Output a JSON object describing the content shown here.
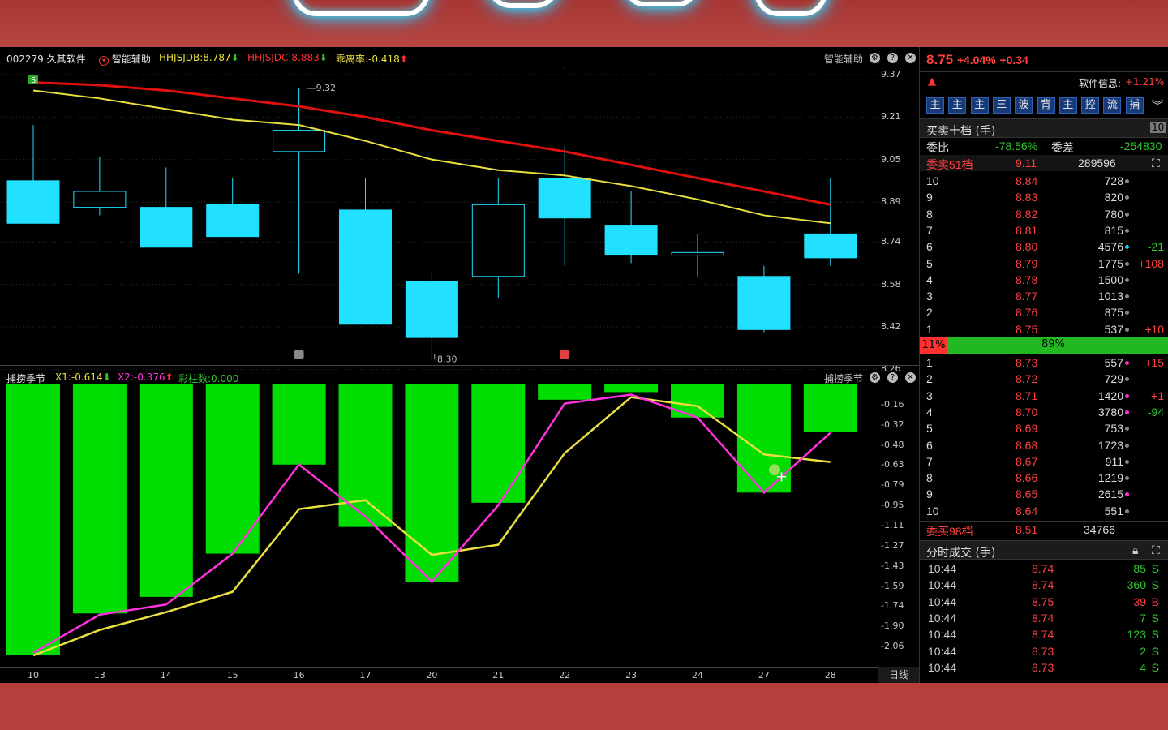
{
  "chart_header": {
    "stock_code_name": "002279 久其软件",
    "assist_label": "智能辅助",
    "hhjsjdb_label": "HHJSJDB:8.787",
    "hhjsjdc_label": "HHJSJDC:8.883",
    "deviation_label": "乖离率:-0.418",
    "right_label": "智能辅助"
  },
  "indicator_header": {
    "name": "捕捞季节",
    "x1_label": "X1:-0.614",
    "x2_label": "X2:-0.376",
    "bar_label": "彩柱数:0.000",
    "right_label": "捕捞季节"
  },
  "price_axis": [
    "9.37",
    "9.21",
    "9.05",
    "8.89",
    "8.74",
    "8.58",
    "8.42",
    "8.26"
  ],
  "indicator_axis": [
    "-0.16",
    "-0.32",
    "-0.48",
    "-0.63",
    "-0.79",
    "-0.95",
    "-1.11",
    "-1.27",
    "-1.43",
    "-1.59",
    "-1.74",
    "-1.90",
    "-2.06"
  ],
  "date_axis": [
    "10",
    "13",
    "14",
    "15",
    "16",
    "17",
    "20",
    "21",
    "22",
    "23",
    "24",
    "27",
    "28"
  ],
  "period_button": "日线",
  "annotations": {
    "high": "9.32",
    "low": "8.30",
    "signal_badge": "S"
  },
  "chart_data": [
    {
      "type": "candlestick",
      "x": [
        "10",
        "13",
        "14",
        "15",
        "16",
        "17",
        "20",
        "21",
        "22",
        "23",
        "24",
        "27",
        "28"
      ],
      "open": [
        8.97,
        8.87,
        8.87,
        8.88,
        9.08,
        8.86,
        8.59,
        8.61,
        8.98,
        8.8,
        8.69,
        8.61,
        8.77
      ],
      "high": [
        9.18,
        9.06,
        9.02,
        8.98,
        9.32,
        8.98,
        8.63,
        8.98,
        9.1,
        8.93,
        8.77,
        8.65,
        8.98
      ],
      "low": [
        8.85,
        8.84,
        8.74,
        8.76,
        8.62,
        8.45,
        8.3,
        8.53,
        8.65,
        8.66,
        8.61,
        8.4,
        8.65
      ],
      "close": [
        8.81,
        8.93,
        8.72,
        8.76,
        9.16,
        8.43,
        8.38,
        8.88,
        8.83,
        8.69,
        8.7,
        8.41,
        8.68
      ],
      "ma_red": [
        9.34,
        9.33,
        9.31,
        9.28,
        9.25,
        9.21,
        9.16,
        9.12,
        9.08,
        9.03,
        8.98,
        8.93,
        8.88
      ],
      "ma_yellow": [
        9.31,
        9.28,
        9.24,
        9.2,
        9.18,
        9.12,
        9.05,
        9.01,
        8.99,
        8.95,
        8.9,
        8.84,
        8.81
      ],
      "ylim": [
        8.24,
        9.4
      ]
    },
    {
      "type": "bar",
      "categories": [
        "10",
        "13",
        "14",
        "15",
        "16",
        "17",
        "20",
        "21",
        "22",
        "23",
        "24",
        "27",
        "28"
      ],
      "values": [
        -2.13,
        -1.8,
        -1.67,
        -1.33,
        -0.63,
        -1.12,
        -1.55,
        -0.93,
        -0.12,
        -0.06,
        -0.26,
        -0.85,
        -0.37
      ],
      "series": [
        {
          "name": "X1",
          "values": [
            -2.13,
            -1.93,
            -1.79,
            -1.63,
            -0.98,
            -0.91,
            -1.34,
            -1.26,
            -0.54,
            -0.1,
            -0.17,
            -0.55,
            -0.61
          ]
        },
        {
          "name": "X2",
          "values": [
            -2.11,
            -1.81,
            -1.73,
            -1.33,
            -0.63,
            -1.04,
            -1.55,
            -0.95,
            -0.15,
            -0.08,
            -0.26,
            -0.85,
            -0.38
          ]
        }
      ],
      "ylim": [
        -2.2,
        0.0
      ]
    }
  ],
  "quote": {
    "price": "8.75",
    "change_pct": "+4.04%",
    "change": "+0.34",
    "info_label": "软件信息:",
    "info_value": "+1.21%"
  },
  "toolbar_buttons": [
    "主",
    "主",
    "主",
    "三",
    "波",
    "背",
    "主",
    "控",
    "流",
    "捕"
  ],
  "order_book": {
    "title": "买卖十档 (手)",
    "badge": "10",
    "ratio_label": "委比",
    "ratio_value": "-78.56%",
    "diff_label": "委差",
    "diff_value": "-254830",
    "sell_total_label": "委卖51档",
    "sell_total_price": "9.11",
    "sell_total_vol": "289596",
    "asks": [
      {
        "level": "10",
        "price": "8.84",
        "vol": "728",
        "chg": "",
        "dot": "#888888"
      },
      {
        "level": "9",
        "price": "8.83",
        "vol": "820",
        "chg": "",
        "dot": "#888888"
      },
      {
        "level": "8",
        "price": "8.82",
        "vol": "780",
        "chg": "",
        "dot": "#888888"
      },
      {
        "level": "7",
        "price": "8.81",
        "vol": "815",
        "chg": "",
        "dot": "#888888"
      },
      {
        "level": "6",
        "price": "8.80",
        "vol": "4576",
        "chg": "-21",
        "dot": "#22d4ff"
      },
      {
        "level": "5",
        "price": "8.79",
        "vol": "1775",
        "chg": "+108",
        "dot": "#888888"
      },
      {
        "level": "4",
        "price": "8.78",
        "vol": "1500",
        "chg": "",
        "dot": "#888888"
      },
      {
        "level": "3",
        "price": "8.77",
        "vol": "1013",
        "chg": "",
        "dot": "#888888"
      },
      {
        "level": "2",
        "price": "8.76",
        "vol": "875",
        "chg": "",
        "dot": "#888888"
      },
      {
        "level": "1",
        "price": "8.75",
        "vol": "537",
        "chg": "+10",
        "dot": "#888888"
      }
    ],
    "split_sell": "11%",
    "split_buy": "89%",
    "bids": [
      {
        "level": "1",
        "price": "8.73",
        "vol": "557",
        "chg": "+15",
        "dot": "#ff33cc"
      },
      {
        "level": "2",
        "price": "8.72",
        "vol": "729",
        "chg": "",
        "dot": "#888888"
      },
      {
        "level": "3",
        "price": "8.71",
        "vol": "1420",
        "chg": "+1",
        "dot": "#ff33cc"
      },
      {
        "level": "4",
        "price": "8.70",
        "vol": "3780",
        "chg": "-94",
        "dot": "#ff33cc"
      },
      {
        "level": "5",
        "price": "8.69",
        "vol": "753",
        "chg": "",
        "dot": "#888888"
      },
      {
        "level": "6",
        "price": "8.68",
        "vol": "1723",
        "chg": "",
        "dot": "#888888"
      },
      {
        "level": "7",
        "price": "8.67",
        "vol": "911",
        "chg": "",
        "dot": "#888888"
      },
      {
        "level": "8",
        "price": "8.66",
        "vol": "1219",
        "chg": "",
        "dot": "#888888"
      },
      {
        "level": "9",
        "price": "8.65",
        "vol": "2615",
        "chg": "",
        "dot": "#ff33cc"
      },
      {
        "level": "10",
        "price": "8.64",
        "vol": "551",
        "chg": "",
        "dot": "#888888"
      }
    ],
    "buy_total_label": "委买98档",
    "buy_total_price": "8.51",
    "buy_total_vol": "34766"
  },
  "trades": {
    "title": "分时成交 (手)",
    "rows": [
      {
        "time": "10:44",
        "price": "8.74",
        "vol": "85",
        "side": "S"
      },
      {
        "time": "10:44",
        "price": "8.74",
        "vol": "360",
        "side": "S"
      },
      {
        "time": "10:44",
        "price": "8.75",
        "vol": "39",
        "side": "B"
      },
      {
        "time": "10:44",
        "price": "8.74",
        "vol": "7",
        "side": "S"
      },
      {
        "time": "10:44",
        "price": "8.74",
        "vol": "123",
        "side": "S"
      },
      {
        "time": "10:44",
        "price": "8.73",
        "vol": "2",
        "side": "S"
      },
      {
        "time": "10:44",
        "price": "8.73",
        "vol": "4",
        "side": "S"
      }
    ]
  },
  "colors": {
    "up": "#ff4040",
    "down": "#22e0ff",
    "bar": "#00dd00",
    "ma_red": "#e01010",
    "ma_yellow": "#e8e040",
    "x1": "#e8e040",
    "x2": "#ff33dd"
  }
}
